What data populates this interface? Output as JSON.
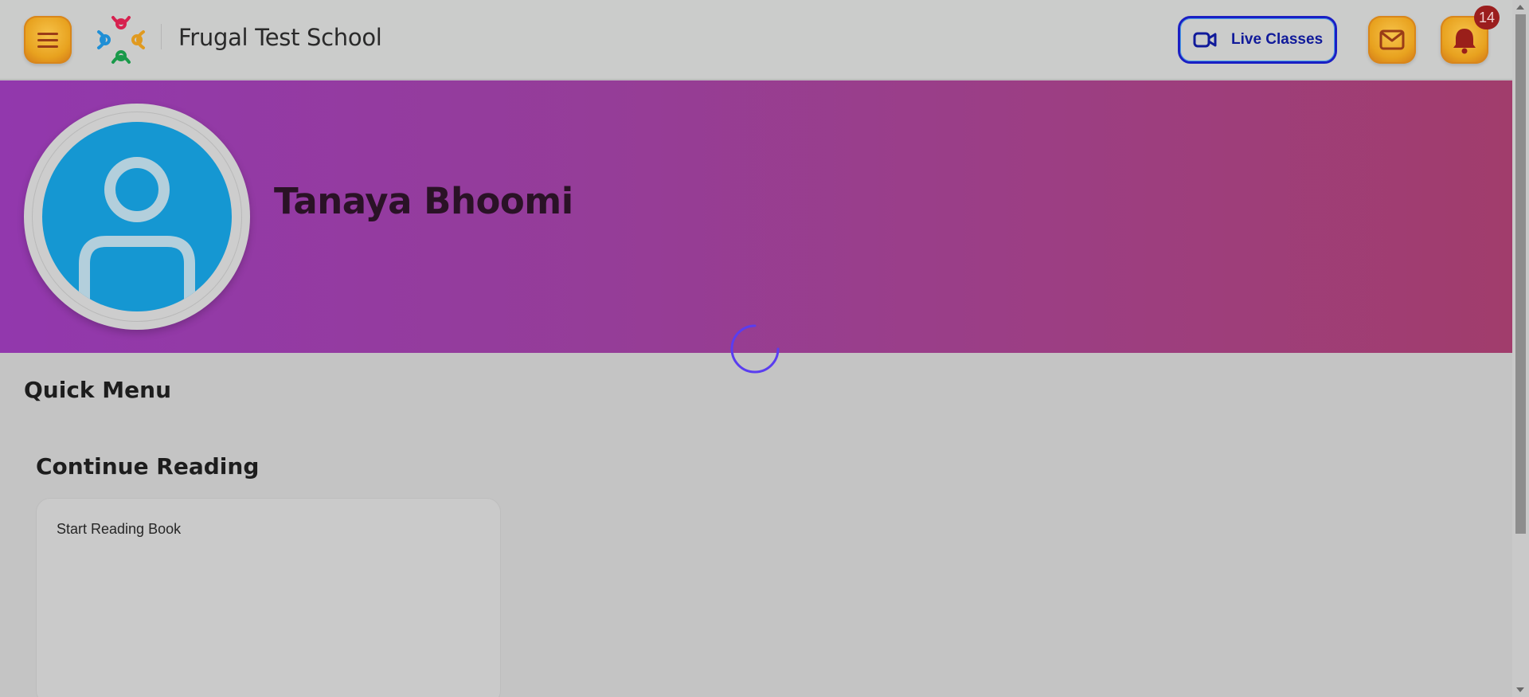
{
  "header": {
    "school_name": "Frugal Test School",
    "live_classes_label": "Live Classes",
    "notification_count": "14"
  },
  "profile": {
    "name": "Tanaya Bhoomi"
  },
  "quick_menu": {
    "title": "Quick Menu"
  },
  "continue_reading": {
    "title": "Continue Reading",
    "card_text": "Start Reading Book"
  },
  "colors": {
    "accent_orange": "#e8a21f",
    "live_border": "#1a1fc4",
    "banner_start": "#9238ad",
    "banner_end": "#a13d6c",
    "avatar_blue": "#1597d2",
    "badge_red": "#9b1e1e",
    "spinner": "#5a3df0"
  },
  "icons": {
    "menu": "hamburger-icon",
    "logo": "school-logo",
    "live": "video-camera-icon",
    "mail": "mail-icon",
    "notifications": "bell-icon",
    "avatar": "user-placeholder-icon",
    "loading": "loading-spinner"
  }
}
